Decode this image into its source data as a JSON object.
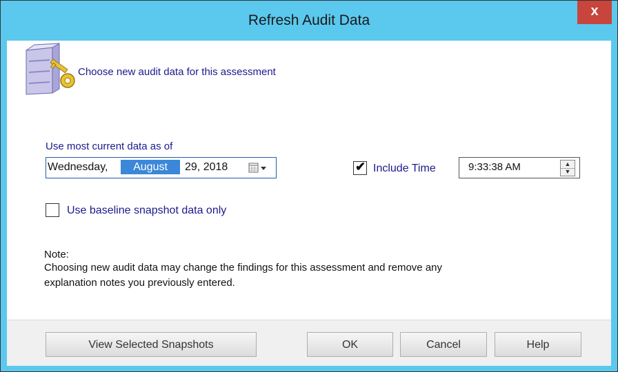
{
  "window": {
    "title": "Refresh Audit Data",
    "close_label": "x"
  },
  "header": {
    "text": "Choose new audit data for this assessment",
    "icon": "server-key-icon"
  },
  "date_section": {
    "label": "Use most current data as of",
    "weekday": "Wednesday,",
    "month": "August",
    "day_year": "29, 2018",
    "calendar_icon": "calendar-icon"
  },
  "include_time": {
    "checked": true,
    "label": "Include Time",
    "value": "9:33:38 AM"
  },
  "baseline": {
    "checked": false,
    "label": "Use baseline snapshot data only"
  },
  "note": {
    "heading": "Note:",
    "line1": "Choosing new audit data may change the findings for this assessment and remove any",
    "line2": "explanation notes you previously entered."
  },
  "buttons": {
    "view_snapshots": "View Selected Snapshots",
    "ok": "OK",
    "cancel": "Cancel",
    "help": "Help"
  },
  "colors": {
    "titlebar": "#5bc8ee",
    "close": "#c7453c",
    "label_blue": "#1a1a8c",
    "selection": "#3b87d9"
  }
}
